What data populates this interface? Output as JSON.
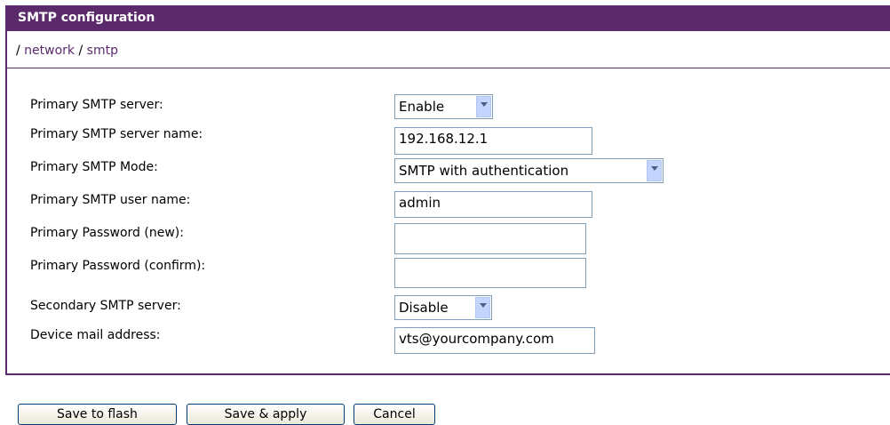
{
  "header": {
    "title": "SMTP configuration"
  },
  "breadcrumb": {
    "sep1": "/",
    "item1": "network",
    "sep2": "/",
    "item2": "smtp"
  },
  "form": {
    "primary_server_label": "Primary SMTP server:",
    "primary_server_value": "Enable",
    "primary_server_name_label": "Primary SMTP server name:",
    "primary_server_name_value": "192.168.12.1",
    "primary_mode_label": "Primary SMTP Mode:",
    "primary_mode_value": "SMTP with authentication",
    "primary_user_label": "Primary SMTP user name:",
    "primary_user_value": "admin",
    "primary_password_new_label": "Primary Password (new):",
    "primary_password_new_value": "",
    "primary_password_confirm_label": "Primary Password (confirm):",
    "primary_password_confirm_value": "",
    "secondary_server_label": "Secondary SMTP server:",
    "secondary_server_value": "Disable",
    "device_mail_label": "Device mail address:",
    "device_mail_value": "vts@yourcompany.com"
  },
  "buttons": {
    "save_flash": "Save to flash",
    "save_apply": "Save & apply",
    "cancel": "Cancel"
  },
  "colors": {
    "accent": "#5a2a6a"
  }
}
